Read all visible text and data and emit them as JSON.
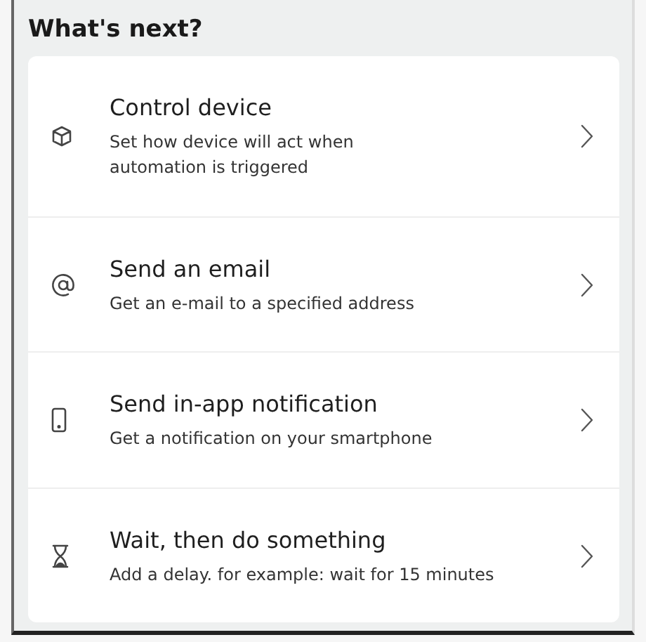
{
  "title": "What's next?",
  "actions": [
    {
      "label": "Control device",
      "description": "Set how device will act when automation is triggered"
    },
    {
      "label": "Send an email",
      "description": "Get an e-mail to a specified address"
    },
    {
      "label": "Send in-app notification",
      "description": "Get a notification on your smartphone"
    },
    {
      "label": "Wait, then do something",
      "description": "Add a delay. for example: wait for 15 minutes"
    }
  ]
}
